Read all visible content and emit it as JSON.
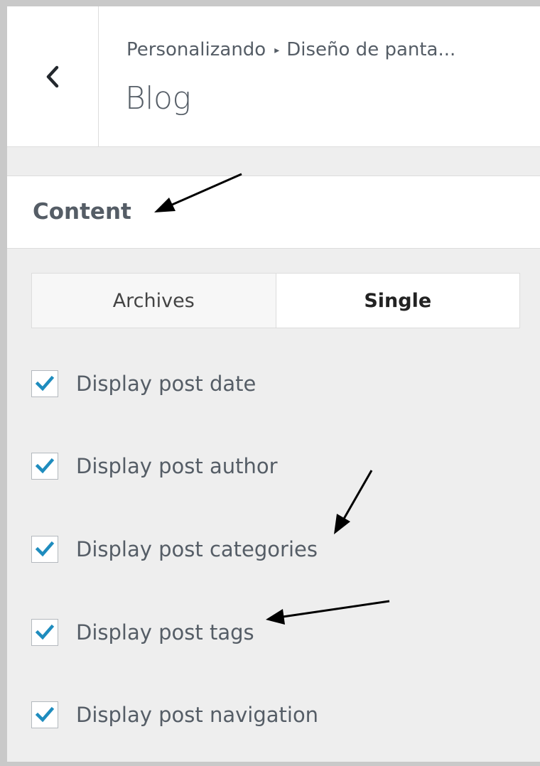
{
  "header": {
    "back_icon": "chevron-left-icon",
    "breadcrumb_parent": "Personalizando",
    "breadcrumb_separator": "▸",
    "breadcrumb_current": "Diseño de panta...",
    "title": "Blog"
  },
  "section": {
    "title": "Content"
  },
  "tabs": [
    {
      "label": "Archives",
      "active": false
    },
    {
      "label": "Single",
      "active": true
    }
  ],
  "options": [
    {
      "label": "Display post date",
      "checked": true
    },
    {
      "label": "Display post author",
      "checked": true
    },
    {
      "label": "Display post categories",
      "checked": true
    },
    {
      "label": "Display post tags",
      "checked": true
    },
    {
      "label": "Display post navigation",
      "checked": true
    }
  ],
  "colors": {
    "check_accent": "#1e8cbe",
    "panel_bg": "#eeeeee",
    "text": "#555d66"
  }
}
